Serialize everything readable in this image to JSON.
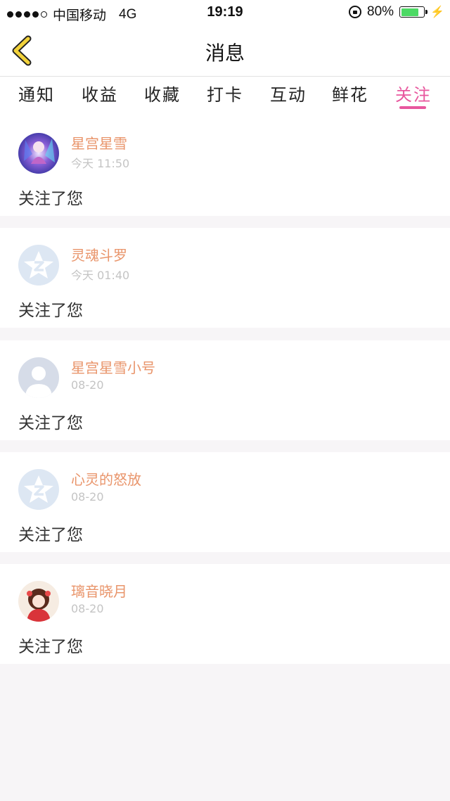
{
  "status_bar": {
    "carrier": "中国移动",
    "network": "4G",
    "time": "19:19",
    "battery": "80%",
    "battery_level": 0.8
  },
  "nav": {
    "title": "消息",
    "back_icon": "back-chevron-icon",
    "accent_color": "#e8579e"
  },
  "tabs": [
    {
      "label": "通知"
    },
    {
      "label": "收益"
    },
    {
      "label": "收藏"
    },
    {
      "label": "打卡"
    },
    {
      "label": "互动"
    },
    {
      "label": "鲜花"
    },
    {
      "label": "关注",
      "active": true
    }
  ],
  "messages": [
    {
      "name": "星宫星雪",
      "time": "今天 11:50",
      "text": "关注了您",
      "avatar": "anime-avatar-purple"
    },
    {
      "name": "灵魂斗罗",
      "time": "今天 01:40",
      "text": "关注了您",
      "avatar": "default-star-avatar"
    },
    {
      "name": "星宫星雪小号",
      "time": "08-20",
      "text": "关注了您",
      "avatar": "default-person-avatar"
    },
    {
      "name": "心灵的怒放",
      "time": "08-20",
      "text": "关注了您",
      "avatar": "default-star-avatar"
    },
    {
      "name": "璃音晓月",
      "time": "08-20",
      "text": "关注了您",
      "avatar": "anime-avatar-red"
    }
  ]
}
